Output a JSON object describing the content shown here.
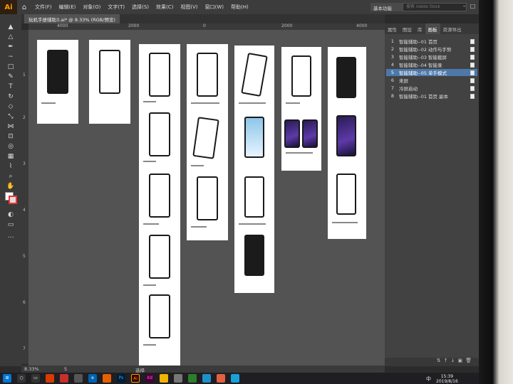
{
  "app": {
    "logo": "Ai",
    "menu": [
      "文件(F)",
      "编辑(E)",
      "对象(O)",
      "文字(T)",
      "选择(S)",
      "效果(C)",
      "视图(V)",
      "窗口(W)",
      "帮助(H)"
    ],
    "workspace": "基本功能",
    "search_placeholder": "搜索 Adobe Stock",
    "document_tab": "玩机手册辅助3.ai* @ 8.33% (RGB/预览)"
  },
  "rulers": {
    "h": [
      "4000",
      "2000",
      "0",
      "2000",
      "4000"
    ],
    "v": [
      "1",
      "2",
      "3",
      "4",
      "5",
      "6",
      "7"
    ]
  },
  "panel": {
    "tabs": [
      "属性",
      "图层",
      "库",
      "画板",
      "资源导出"
    ],
    "active_tab": "画板",
    "artboards": [
      {
        "num": "1",
        "name": "智能辅助--01 首页"
      },
      {
        "num": "2",
        "name": "智能辅助--02 动作与手势"
      },
      {
        "num": "3",
        "name": "智能辅助--03 智能截屏"
      },
      {
        "num": "4",
        "name": "智能辅助--04 智能录"
      },
      {
        "num": "5",
        "name": "智能辅助--05 单手模式"
      },
      {
        "num": "6",
        "name": "来屏"
      },
      {
        "num": "7",
        "name": "冷屏启动"
      },
      {
        "num": "8",
        "name": "智能辅助--01 首页 副本"
      }
    ],
    "selected_index": 4
  },
  "status": {
    "zoom": "8.33%",
    "page": "5",
    "tool_label": "选择"
  },
  "taskbar": {
    "time": "15:39",
    "date": "2019/8/16",
    "ime": "中"
  }
}
